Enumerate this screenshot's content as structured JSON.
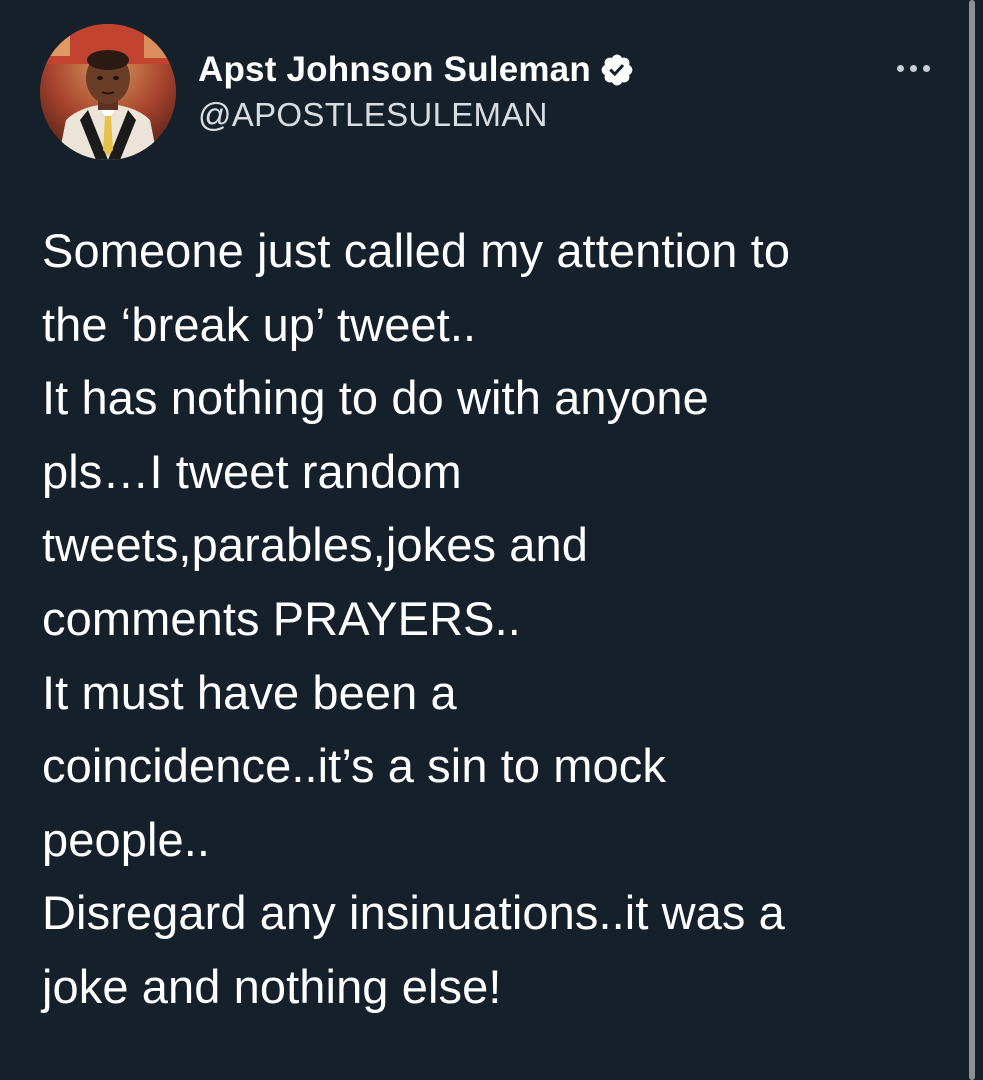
{
  "author": {
    "display_name": "Apst Johnson Suleman",
    "handle": "@APOSTLESULEMAN",
    "verified": true,
    "avatar_icon": "profile-photo"
  },
  "actions": {
    "more_icon": "more-horizontal-icon"
  },
  "tweet": {
    "lines": [
      "Someone just called my attention to",
      "the ‘break up’ tweet..",
      "It has nothing to do with anyone",
      "pls…I tweet random",
      "tweets,parables,jokes and",
      "comments PRAYERS..",
      "It must have been a",
      "coincidence..it’s a sin to mock",
      "people..",
      "Disregard any insinuations..it was a",
      "joke and nothing else!"
    ]
  },
  "colors": {
    "background": "#15202b",
    "text_primary": "#ffffff",
    "text_secondary": "#d9dde1",
    "verified_badge": "#ffffff"
  }
}
